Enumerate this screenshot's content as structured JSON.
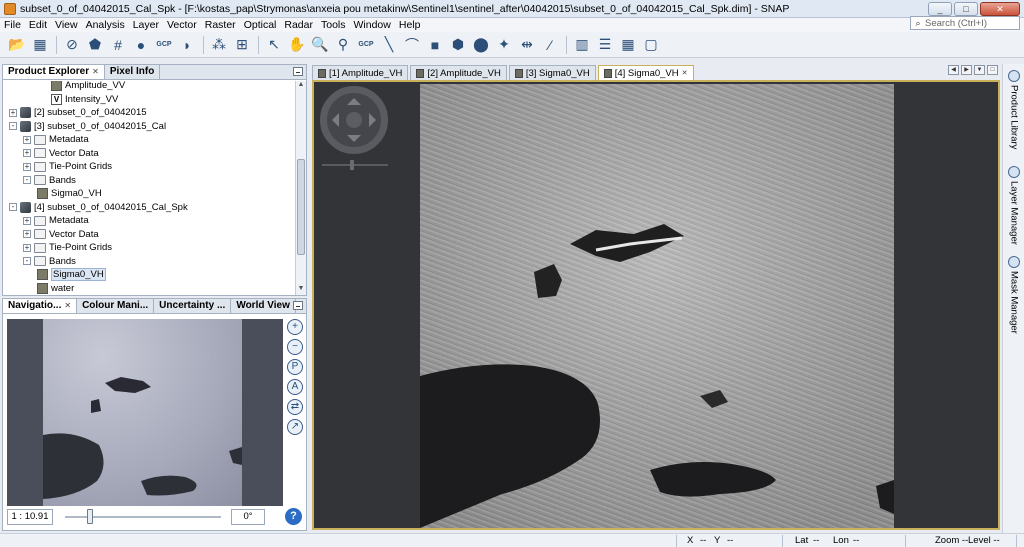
{
  "window": {
    "title": "subset_0_of_04042015_Cal_Spk - [F:\\kostas_pap\\Strymonas\\anxeia pou metakinw\\Sentinel1\\sentinel_after\\04042015\\subset_0_of_04042015_Cal_Spk.dim] - SNAP",
    "minimize": "_",
    "maximize": "□",
    "close": "✕"
  },
  "menu": [
    "File",
    "Edit",
    "View",
    "Analysis",
    "Layer",
    "Vector",
    "Raster",
    "Optical",
    "Radar",
    "Tools",
    "Window",
    "Help"
  ],
  "search": {
    "placeholder": "Search (Ctrl+I)"
  },
  "toolbar": {
    "gcp_label_1": "GCP",
    "gcp_label_2": "GCP"
  },
  "product_explorer": {
    "tabs": [
      "Product Explorer",
      "Pixel Info"
    ],
    "tree": [
      {
        "label": "Amplitude_VV",
        "level": 3,
        "type": "band"
      },
      {
        "label": "Intensity_VV",
        "level": 3,
        "type": "virtual"
      },
      {
        "label": "[2] subset_0_of_04042015",
        "level": 0,
        "type": "product",
        "toggle": "+"
      },
      {
        "label": "[3] subset_0_of_04042015_Cal",
        "level": 0,
        "type": "product",
        "toggle": "-"
      },
      {
        "label": "Metadata",
        "level": 1,
        "type": "folder",
        "toggle": "+"
      },
      {
        "label": "Vector Data",
        "level": 1,
        "type": "folder",
        "toggle": "+"
      },
      {
        "label": "Tie-Point Grids",
        "level": 1,
        "type": "folder",
        "toggle": "+"
      },
      {
        "label": "Bands",
        "level": 1,
        "type": "folder",
        "toggle": "-"
      },
      {
        "label": "Sigma0_VH",
        "level": 2,
        "type": "band"
      },
      {
        "label": "[4] subset_0_of_04042015_Cal_Spk",
        "level": 0,
        "type": "product",
        "toggle": "-"
      },
      {
        "label": "Metadata",
        "level": 1,
        "type": "folder",
        "toggle": "+"
      },
      {
        "label": "Vector Data",
        "level": 1,
        "type": "folder",
        "toggle": "+"
      },
      {
        "label": "Tie-Point Grids",
        "level": 1,
        "type": "folder",
        "toggle": "+"
      },
      {
        "label": "Bands",
        "level": 1,
        "type": "folder",
        "toggle": "-"
      },
      {
        "label": "Sigma0_VH",
        "level": 2,
        "type": "band",
        "selected": true
      },
      {
        "label": "water",
        "level": 2,
        "type": "band"
      }
    ]
  },
  "lower_panel": {
    "tabs": [
      "Navigatio...",
      "Colour Mani...",
      "Uncertainty ...",
      "World View"
    ],
    "scale": "1 : 10.91",
    "angle": "0°",
    "help": "?"
  },
  "editor": {
    "tabs": [
      "[1] Amplitude_VH",
      "[2] Amplitude_VH",
      "[3] Sigma0_VH",
      "[4] Sigma0_VH"
    ],
    "active_tab": 3
  },
  "side_tabs": [
    "Product Library",
    "Layer Manager",
    "Mask Manager"
  ],
  "status": {
    "x": "X",
    "x_val": "--",
    "y": "Y",
    "y_val": "--",
    "lat": "Lat",
    "lat_val": "--",
    "lon": "Lon",
    "lon_val": "--",
    "zoom": "Zoom --",
    "level": "Level --"
  }
}
